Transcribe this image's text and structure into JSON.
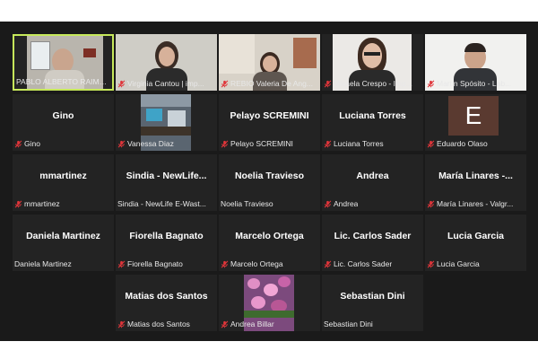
{
  "participants": [
    {
      "label": "PABLO ALBERTO RAIMO...",
      "muted": false,
      "video": "room-man",
      "active": true
    },
    {
      "label": "Virginia Cantou | imp...",
      "muted": true,
      "video": "woman-wall"
    },
    {
      "label": "REBIO Valeria De Ang...",
      "muted": true,
      "video": "woman-room"
    },
    {
      "label": "Micaela Crespo - Imp...",
      "muted": true,
      "video": "woman-glasses"
    },
    {
      "label": "Martin Spósito - Lab...",
      "muted": true,
      "video": "man-white"
    },
    {
      "name": "Gino",
      "label": "Gino",
      "muted": true
    },
    {
      "label": "Vanessa Diaz",
      "muted": true,
      "video": "kitchen"
    },
    {
      "name": "Pelayo SCREMINI",
      "label": "Pelayo SCREMINI",
      "muted": true
    },
    {
      "name": "Luciana Torres",
      "label": "Luciana Torres",
      "muted": true
    },
    {
      "label": "Eduardo Olaso",
      "muted": true,
      "avatar": "E"
    },
    {
      "name": "mmartinez",
      "label": "mmartinez",
      "muted": true
    },
    {
      "name": "Sindia - NewLife...",
      "label": "Sindia - NewLife E-Wast...",
      "muted": false
    },
    {
      "name": "Noelia Travieso",
      "label": "Noelia Travieso",
      "muted": false
    },
    {
      "name": "Andrea",
      "label": "Andrea",
      "muted": true
    },
    {
      "name": "María Linares -...",
      "label": "María Linares - Valgr...",
      "muted": true
    },
    {
      "name": "Daniela Martinez",
      "label": "Daniela Martinez",
      "muted": false
    },
    {
      "name": "Fiorella Bagnato",
      "label": "Fiorella Bagnato",
      "muted": true
    },
    {
      "name": "Marcelo Ortega",
      "label": "Marcelo Ortega",
      "muted": true
    },
    {
      "name": "Lic. Carlos Sader",
      "label": "Lic. Carlos Sader",
      "muted": true
    },
    {
      "name": "Lucia Garcia",
      "label": "Lucia Garcia",
      "muted": true
    },
    {
      "empty": true
    },
    {
      "name": "Matias dos Santos",
      "label": "Matias dos Santos",
      "muted": true
    },
    {
      "label": "Andrea Billar",
      "muted": true,
      "video": "flowers"
    },
    {
      "name": "Sebastian Dini",
      "label": "Sebastian Dini",
      "muted": false
    }
  ],
  "colors": {
    "background": "#1a1a1a",
    "tile": "#232323",
    "active_border": "#c6e85a",
    "muted_icon": "#e0353a"
  }
}
